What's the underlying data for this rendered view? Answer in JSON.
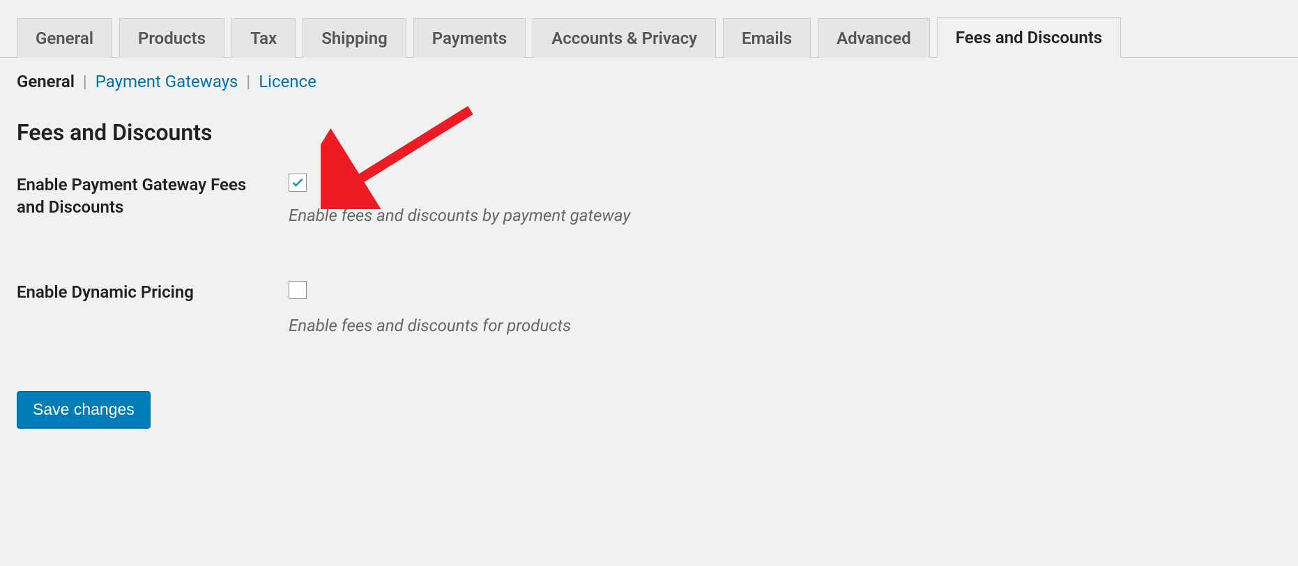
{
  "tabs": [
    {
      "label": "General",
      "active": false
    },
    {
      "label": "Products",
      "active": false
    },
    {
      "label": "Tax",
      "active": false
    },
    {
      "label": "Shipping",
      "active": false
    },
    {
      "label": "Payments",
      "active": false
    },
    {
      "label": "Accounts & Privacy",
      "active": false
    },
    {
      "label": "Emails",
      "active": false
    },
    {
      "label": "Advanced",
      "active": false
    },
    {
      "label": "Fees and Discounts",
      "active": true
    }
  ],
  "subnav": [
    {
      "label": "General",
      "active": true
    },
    {
      "label": "Payment Gateways",
      "active": false
    },
    {
      "label": "Licence",
      "active": false
    }
  ],
  "section_title": "Fees and Discounts",
  "settings": {
    "enable_gateway": {
      "label": "Enable Payment Gateway Fees and Discounts",
      "checked": true,
      "description": "Enable fees and discounts by payment gateway"
    },
    "enable_dynamic": {
      "label": "Enable Dynamic Pricing",
      "checked": false,
      "description": "Enable fees and discounts for products"
    }
  },
  "save_button": "Save changes"
}
